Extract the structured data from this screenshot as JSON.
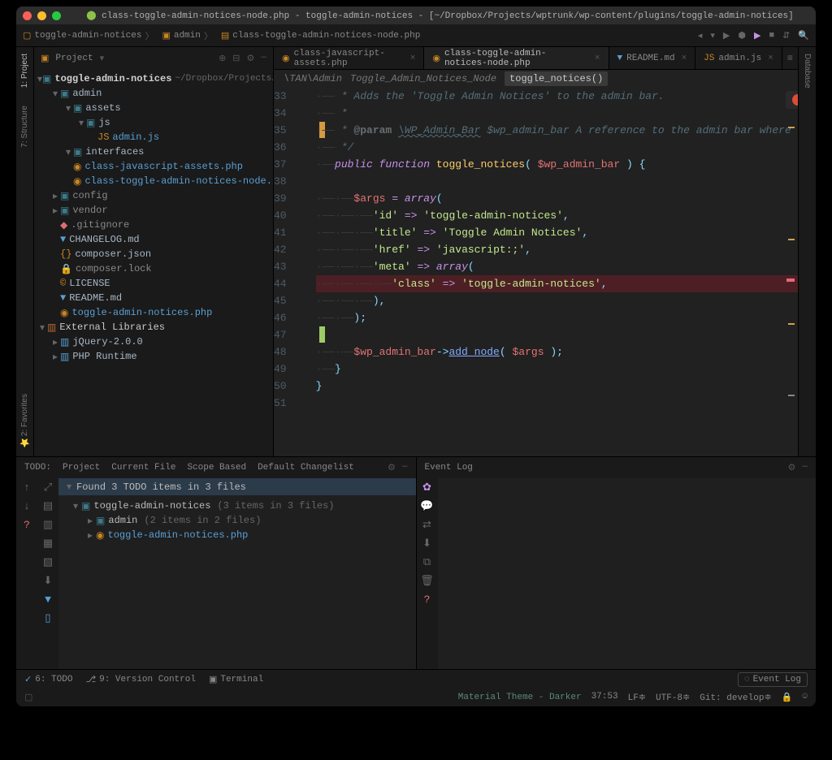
{
  "titlebar": {
    "filename": "class-toggle-admin-notices-node.php",
    "project": "toggle-admin-notices",
    "path": "[~/Dropbox/Projects/wptrunk/wp-content/plugins/toggle-admin-notices]"
  },
  "navbar": {
    "seg1": "toggle-admin-notices",
    "seg2": "admin",
    "seg3": "class-toggle-admin-notices-node.php"
  },
  "project_panel": {
    "label": "Project"
  },
  "tree": {
    "root": "toggle-admin-notices",
    "root_path": "~/Dropbox/Projects/wpt",
    "admin": "admin",
    "assets": "assets",
    "js": "js",
    "adminjs": "admin.js",
    "interfaces": "interfaces",
    "cja": "class-javascript-assets.php",
    "ctan": "class-toggle-admin-notices-node.php",
    "config": "config",
    "vendor": "vendor",
    "gitignore": ".gitignore",
    "changelog": "CHANGELOG.md",
    "composerjson": "composer.json",
    "composerlock": "composer.lock",
    "license": "LICENSE",
    "readme": "README.md",
    "tanphp": "toggle-admin-notices.php",
    "extlib": "External Libraries",
    "jquery": "jQuery-2.0.0",
    "phprt": "PHP Runtime"
  },
  "tabs": [
    {
      "label": "class-javascript-assets.php",
      "active": false,
      "icon": "php"
    },
    {
      "label": "class-toggle-admin-notices-node.php",
      "active": true,
      "icon": "php"
    },
    {
      "label": "README.md",
      "active": false,
      "icon": "md"
    },
    {
      "label": "admin.js",
      "active": false,
      "icon": "js"
    }
  ],
  "crumbs": {
    "ns": "\\TAN\\Admin",
    "cls": "Toggle_Admin_Notices_Node",
    "fn": "toggle_notices()"
  },
  "code": {
    "lines": [
      {
        "n": 33,
        "type": "comment",
        "text": " * Adds the 'Toggle Admin Notices' to the admin bar."
      },
      {
        "n": 34,
        "type": "comment",
        "text": " *"
      },
      {
        "n": 35,
        "type": "param",
        "tag": "@param",
        "cls": "\\WP_Admin_Bar",
        "var": "$wp_admin_bar",
        "desc": "A reference to the admin bar where we're adding"
      },
      {
        "n": 36,
        "type": "comment",
        "text": " */"
      },
      {
        "n": 37,
        "type": "fn",
        "kw": "public function",
        "fn": "toggle_notices",
        "args": "$wp_admin_bar"
      },
      {
        "n": 38,
        "type": "blank"
      },
      {
        "n": 39,
        "type": "assign",
        "var": "$args",
        "op": "=",
        "kw": "array"
      },
      {
        "n": 40,
        "type": "arr",
        "key": "'id'",
        "arrow": "=>",
        "val": "'toggle-admin-notices'",
        "comma": true
      },
      {
        "n": 41,
        "type": "arr",
        "key": "'title'",
        "arrow": "=>",
        "val": "'Toggle Admin Notices'",
        "comma": true
      },
      {
        "n": 42,
        "type": "arr",
        "key": "'href'",
        "arrow": "=>",
        "val": "'javascript:;'",
        "comma": true
      },
      {
        "n": 43,
        "type": "arr2",
        "key": "'meta'",
        "arrow": "=>",
        "kw": "array"
      },
      {
        "n": 44,
        "type": "arr_inner",
        "key": "'class'",
        "arrow": "=>",
        "val": "'toggle-admin-notices'",
        "comma": true,
        "bp": true
      },
      {
        "n": 45,
        "type": "close_inner",
        "text": "),"
      },
      {
        "n": 46,
        "type": "close_outer",
        "text": ");"
      },
      {
        "n": 47,
        "type": "blank"
      },
      {
        "n": 48,
        "type": "call",
        "var": "$wp_admin_bar",
        "method": "add_node",
        "args": "$args"
      },
      {
        "n": 49,
        "type": "close_fn",
        "text": "}"
      },
      {
        "n": 50,
        "type": "close_cls",
        "text": "}"
      },
      {
        "n": 51,
        "type": "blank"
      }
    ]
  },
  "todo": {
    "tab_todo": "TODO:",
    "tab_project": "Project",
    "tab_current": "Current File",
    "tab_scope": "Scope Based",
    "tab_changelist": "Default Changelist",
    "found": "Found 3 TODO items in 3 files",
    "root": "toggle-admin-notices",
    "root_count": "(3 items in 3 files)",
    "admin": "admin",
    "admin_count": "(2 items in 2 files)",
    "tanphp": "toggle-admin-notices.php"
  },
  "eventlog": {
    "label": "Event Log"
  },
  "bottombar": {
    "todo": "6: TODO",
    "vc": "9: Version Control",
    "term": "Terminal",
    "evt": "Event Log"
  },
  "status": {
    "theme": "Material Theme - Darker",
    "pos": "37:53",
    "lf": "LF≑",
    "enc": "UTF-8≑",
    "git": "Git: develop≑"
  }
}
